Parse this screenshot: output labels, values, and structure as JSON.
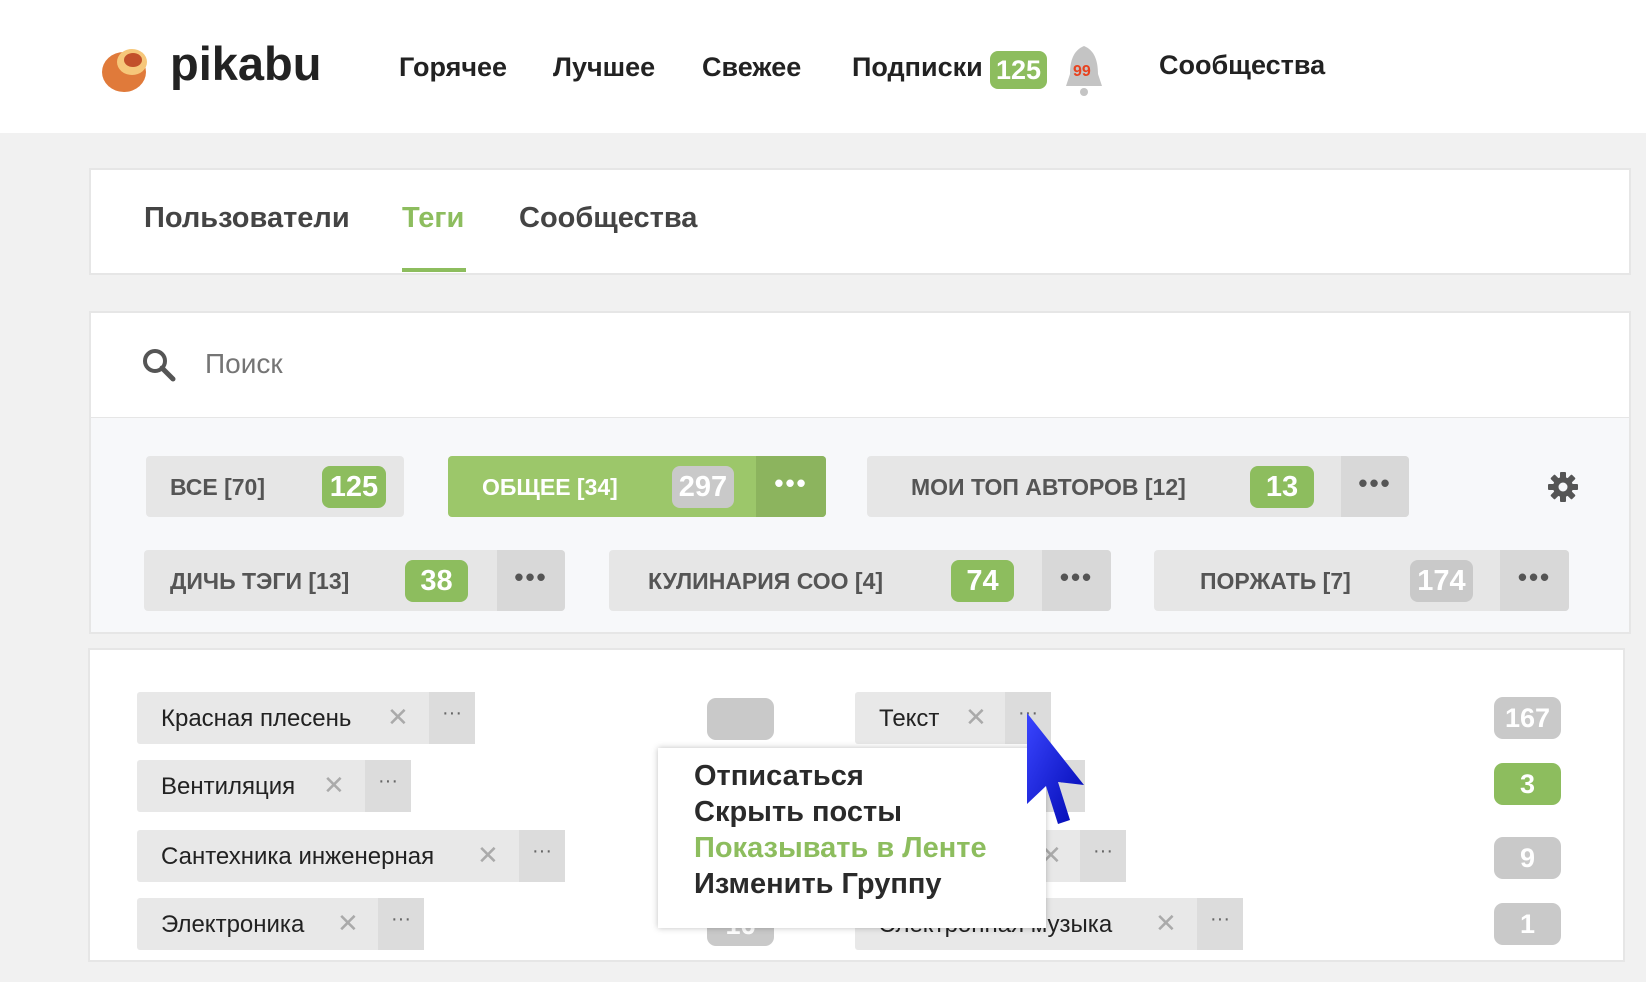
{
  "header": {
    "logo_text": "pikabu",
    "nav": [
      "Горячее",
      "Лучшее",
      "Свежее",
      "Подписки",
      "Сообщества"
    ],
    "subscriptions_badge": "125",
    "notifications_badge": "99"
  },
  "tabs": {
    "items": [
      "Пользователи",
      "Теги",
      "Сообщества"
    ],
    "active": "Теги"
  },
  "search": {
    "placeholder": "Поиск"
  },
  "groups": [
    {
      "label": "ВСЕ [70]",
      "count": "125",
      "count_color": "green"
    },
    {
      "label": "ОБЩЕЕ [34]",
      "count": "297",
      "count_color": "grey",
      "active": true
    },
    {
      "label": "МОИ ТОП АВТОРОВ [12]",
      "count": "13",
      "count_color": "green"
    },
    {
      "label": "ДИЧЬ ТЭГИ [13]",
      "count": "38",
      "count_color": "green"
    },
    {
      "label": "КУЛИНАРИЯ СОО [4]",
      "count": "74",
      "count_color": "green"
    },
    {
      "label": "ПОРЖАТЬ [7]",
      "count": "174",
      "count_color": "grey"
    }
  ],
  "tags_left": [
    "Красная плесень",
    "Вентиляция",
    "Сантехника инженерная",
    "Электроника"
  ],
  "tags_middle": [
    "Текст",
    "Электронная музыка"
  ],
  "middle_count_partial": "16",
  "counts_right": [
    "167",
    "3",
    "9",
    "1"
  ],
  "context_menu": [
    "Отписаться",
    "Скрыть посты",
    "Показывать в Ленте",
    "Изменить Группу"
  ],
  "colors": {
    "accent": "#8dbd5e",
    "badge_grey": "#c9c9c9",
    "cursor": "#0a12d8"
  }
}
